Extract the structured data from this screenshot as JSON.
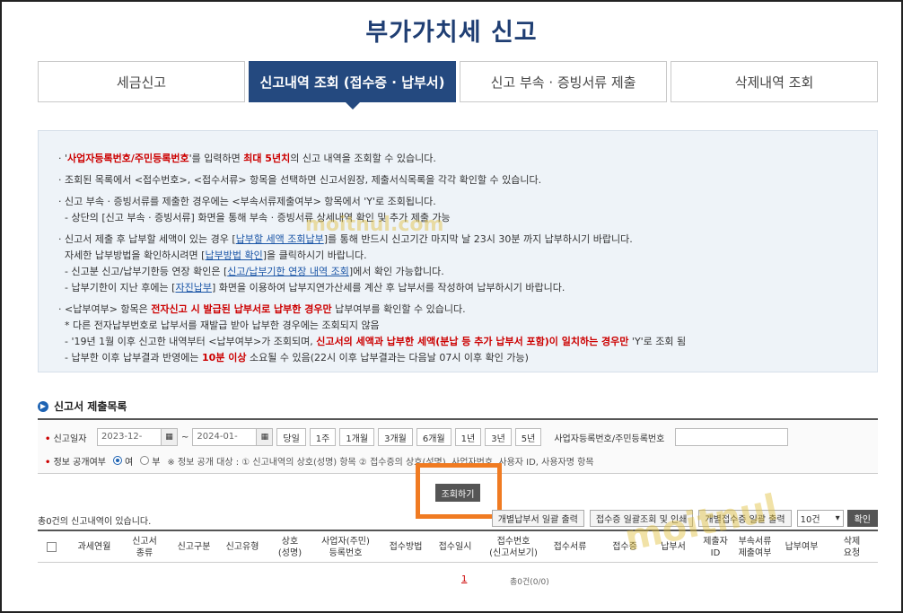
{
  "page": {
    "title": "부가가치세 신고"
  },
  "tabs": [
    {
      "label": "세금신고",
      "active": false
    },
    {
      "label": "신고내역 조회 (접수증 · 납부서)",
      "active": true
    },
    {
      "label": "신고 부속 · 증빙서류 제출",
      "active": false
    },
    {
      "label": "삭제내역 조회",
      "active": false
    }
  ],
  "notice": {
    "l1_a": "· '",
    "l1_b": "사업자등록번호/주민등록번호",
    "l1_c": "'를 입력하면 ",
    "l1_d": "최대 5년치",
    "l1_e": "의 신고 내역을 조회할 수 있습니다.",
    "l2": "· 조회된 목록에서 <접수번호>, <접수서류> 항목을 선택하면 신고서원장, 제출서식목록을 각각 확인할 수 있습니다.",
    "l3": "· 신고 부속 · 증빙서류를 제출한 경우에는 <부속서류제출여부> 항목에서 'Y'로 조회됩니다.",
    "l4": "  - 상단의 [신고 부속 · 증빙서류] 화면을 통해 부속 · 증빙서류 상세내역 확인 및 추가 제출 가능",
    "l5_a": "· 신고서 제출 후 납부할 세액이 있는 경우 [",
    "l5_b": "납부할 세액 조회납부",
    "l5_c": "]를 통해 반드시 신고기간 마지막 날 23시 30분 까지 납부하시기 바랍니다.",
    "l6_a": "  자세한 납부방법을 확인하시려면 [",
    "l6_b": "납부방법 확인",
    "l6_c": "]을 클릭하시기 바랍니다.",
    "l7_a": "  - 신고분 신고/납부기한등 연장 확인은 [",
    "l7_b": "신고/납부기한 연장 내역 조회",
    "l7_c": "]에서 확인 가능합니다.",
    "l8_a": "  - 납부기한이 지난 후에는 [",
    "l8_b": "자진납부",
    "l8_c": "] 화면을 이용하여 납부지연가산세를 계산 후 납부서를 작성하여 납부하시기 바랍니다.",
    "l9_a": "· <납부여부> 항목은 ",
    "l9_b": "전자신고 시 발급된 납부서로 납부한 경우만",
    "l9_c": " 납부여부를 확인할 수 있습니다.",
    "l10": "  * 다른 전자납부번호로 납부서를 재발급 받아 납부한 경우에는 조회되지 않음",
    "l11_a": "  - '19년 1월 이후 신고한 내역부터 <납부여부>가 조회되며, ",
    "l11_b": "신고서의 세액과 납부한 세액(분납 등 추가 납부서 포함)이 일치하는 경우만",
    "l11_c": " 'Y'로 조회 됨",
    "l12_a": "  - 납부한 이후 납부결과 반영에는 ",
    "l12_b": "10분 이상",
    "l12_c": " 소요될 수 있음(22시 이후 납부결과는 다음날 07시 이후 확인 가능)"
  },
  "section": {
    "title": "신고서 제출목록"
  },
  "search": {
    "date_label": "신고일자",
    "date_from": "2023-12-",
    "date_to": "2024-01-",
    "tilde": "~",
    "periods": [
      "당일",
      "1주",
      "1개월",
      "3개월",
      "6개월",
      "1년",
      "3년",
      "5년"
    ],
    "biz_label": "사업자등록번호/주민등록번호",
    "biz_value": "",
    "disclose_label": "정보 공개여부",
    "opt_yes": "여",
    "opt_no": "부",
    "disclose_note": "※ 정보 공개 대상 : ① 신고내역의 상호(성명) 항목 ② 접수증의 상호(성명), 사업자번호, 사용자 ID, 사용자명 항목",
    "query_button": "조회하기"
  },
  "results": {
    "count_text": "총0건의 신고내역이 있습니다.",
    "btn_bulk_print": "개별납부서 일괄 출력",
    "btn_receipt": "접수증 일괄조회 및 인쇄",
    "btn_individual": "개별접수증 일괄 출력",
    "page_size": "10건",
    "confirm": "확인"
  },
  "table": {
    "headers": [
      "과세연월",
      "신고서\n종류",
      "신고구분",
      "신고유형",
      "상호\n(성명)",
      "사업자(주민)\n등록번호",
      "접수방법",
      "접수일시",
      "접수번호\n(신고서보기)",
      "접수서류",
      "접수증",
      "납부서",
      "제출자\nID",
      "부속서류\n제출여부",
      "납부여부",
      "삭제\n요청"
    ]
  },
  "pager": {
    "current": "1",
    "count": "총0건(0/0)"
  },
  "watermark": {
    "text1": "moitnul.com",
    "text2": "moitnul"
  },
  "colors": {
    "brand": "#1f3e73",
    "active_tab": "#24497f",
    "highlight": "#f07b22",
    "emphasis": "#c00000"
  }
}
